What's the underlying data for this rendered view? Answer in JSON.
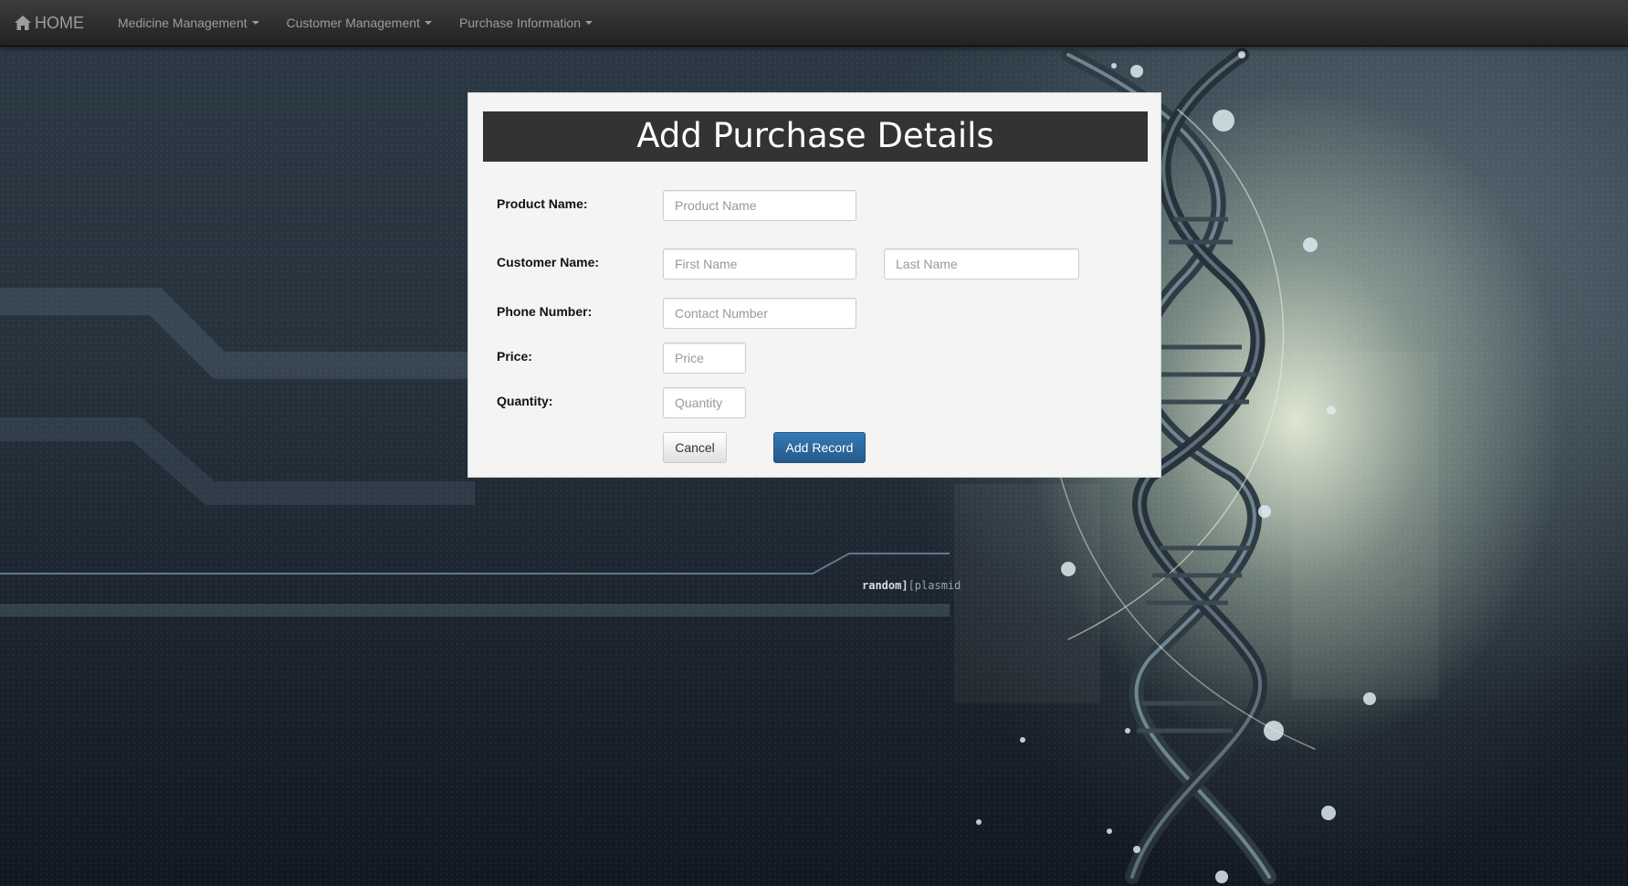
{
  "navbar": {
    "brand_label": "HOME",
    "brand_icon": "home-icon",
    "items": [
      {
        "label": "Medicine Management"
      },
      {
        "label": "Customer Management"
      },
      {
        "label": "Purchase Information"
      }
    ]
  },
  "form": {
    "title": "Add Purchase Details",
    "product_name": {
      "label": "Product Name:",
      "placeholder": "Product Name",
      "value": ""
    },
    "customer_name": {
      "label": "Customer Name:",
      "first": {
        "placeholder": "First Name",
        "value": ""
      },
      "last": {
        "placeholder": "Last Name",
        "value": ""
      }
    },
    "phone_number": {
      "label": "Phone Number:",
      "placeholder": "Contact Number",
      "value": ""
    },
    "price": {
      "label": "Price:",
      "placeholder": "Price",
      "value": ""
    },
    "quantity": {
      "label": "Quantity:",
      "placeholder": "Quantity",
      "value": ""
    },
    "cancel_label": "Cancel",
    "submit_label": "Add Record"
  },
  "background": {
    "watermark_main": "random]",
    "watermark_dim": "[plasmid"
  },
  "colors": {
    "navbar": "#222222",
    "header": "#333333",
    "primary": "#337ab7"
  }
}
